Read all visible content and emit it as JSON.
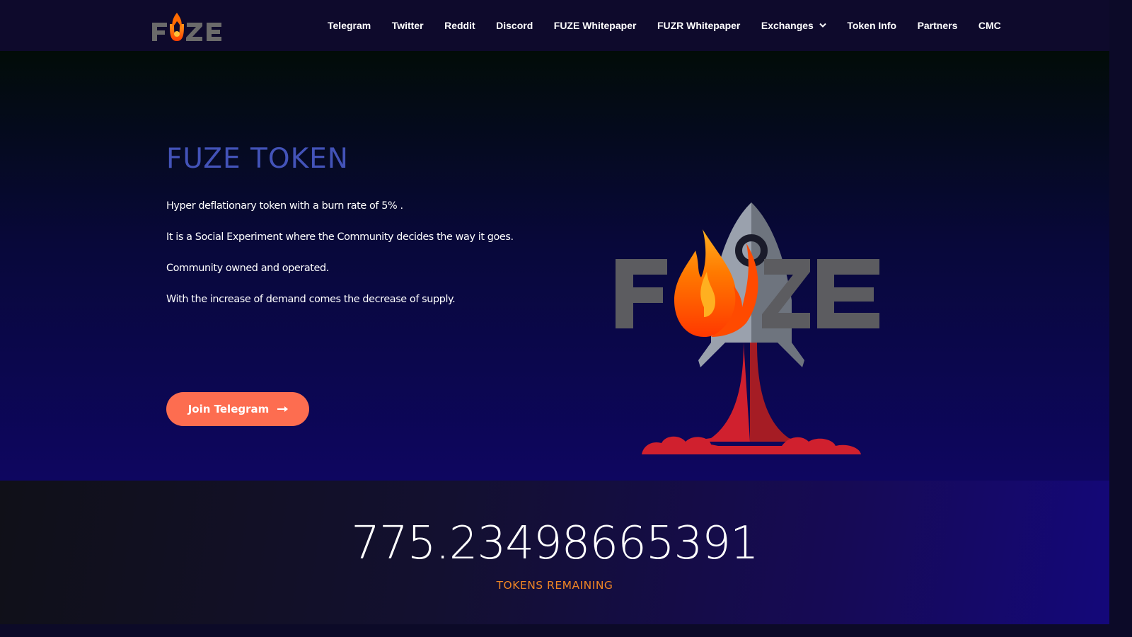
{
  "brand": {
    "logo_text": "FUZE",
    "accent_color": "#f08524"
  },
  "nav": {
    "items": [
      {
        "label": "Telegram"
      },
      {
        "label": "Twitter"
      },
      {
        "label": "Reddit"
      },
      {
        "label": "Discord"
      },
      {
        "label": "FUZE Whitepaper"
      },
      {
        "label": "FUZR Whitepaper"
      },
      {
        "label": "Exchanges",
        "icon": "chevron-down-icon"
      },
      {
        "label": "Token Info"
      },
      {
        "label": "Partners"
      },
      {
        "label": "CMC"
      }
    ]
  },
  "hero": {
    "title": "FUZE TOKEN",
    "title_color": "#4353b8",
    "paragraphs": [
      "Hyper deflationary token with a burn rate of 5% .",
      "It is a Social Experiment where the Community decides the way it goes.",
      "Community owned and operated.",
      "With the increase of demand comes the decrease of supply."
    ],
    "cta": {
      "label": "Join Telegram",
      "icon": "arrow-right-icon",
      "color": "#fd6d50"
    },
    "logo_text": "FUZE"
  },
  "counter": {
    "value": "775.23498665391",
    "label": "TOKENS REMAINING"
  }
}
